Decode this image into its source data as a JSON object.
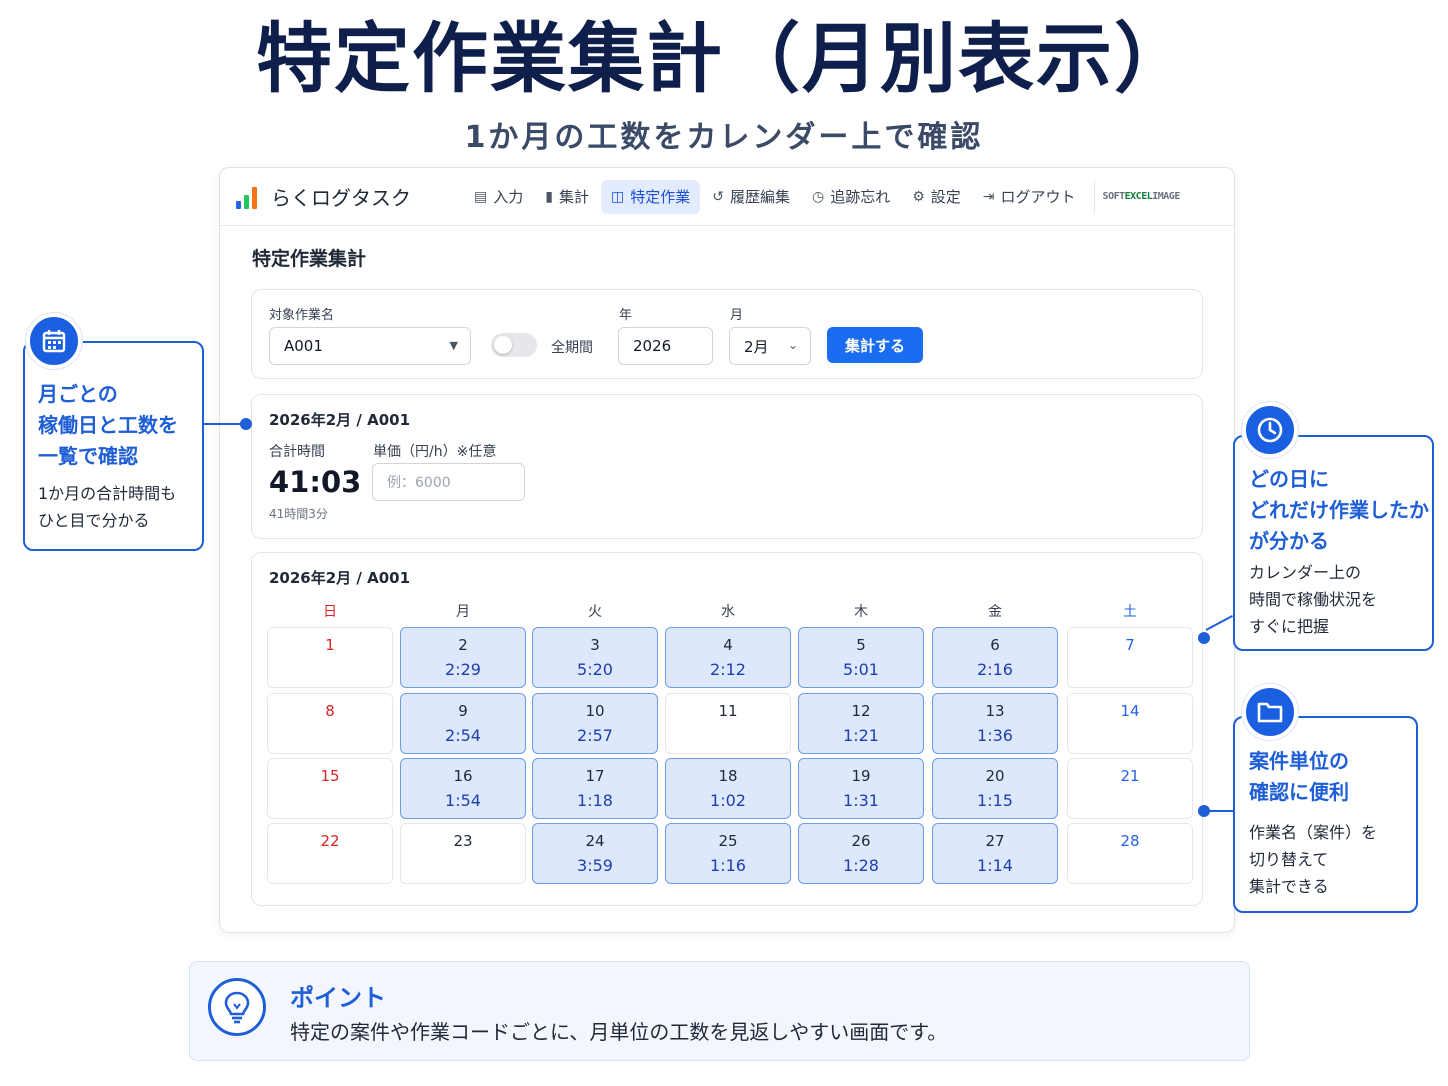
{
  "hero": {
    "title": "特定作業集計（月別表示）",
    "subtitle": "1か月の工数をカレンダー上で確認"
  },
  "app": {
    "brand_name": "らくログタスク",
    "nav": [
      {
        "label": "入力",
        "icon": "clipboard-icon"
      },
      {
        "label": "集計",
        "icon": "bar-chart-icon"
      },
      {
        "label": "特定作業",
        "icon": "book-icon",
        "active": true
      },
      {
        "label": "履歴編集",
        "icon": "history-icon"
      },
      {
        "label": "追跡忘れ",
        "icon": "clock-icon"
      },
      {
        "label": "設定",
        "icon": "gear-icon"
      },
      {
        "label": "ログアウト",
        "icon": "logout-icon"
      }
    ],
    "vendor_logo": {
      "soft": "SOFT",
      "excel": "EXCEL",
      "image": "IMAGE"
    },
    "page_title": "特定作業集計",
    "filter": {
      "task_label": "対象作業名",
      "task_value": "A001",
      "all_period_label": "全期間",
      "all_period_on": false,
      "year_label": "年",
      "year_value": "2026",
      "month_label": "月",
      "month_value": "2月",
      "submit_label": "集計する"
    },
    "summary": {
      "caption": "2026年2月 / A001",
      "total_label": "合計時間",
      "total_value": "41:03",
      "total_sub": "41時間3分",
      "price_label": "単価（円/h）※任意",
      "price_placeholder": "例：6000"
    },
    "calendar": {
      "caption": "2026年2月 / A001",
      "weekdays": [
        "日",
        "月",
        "火",
        "水",
        "木",
        "金",
        "土"
      ],
      "weeks": [
        [
          {
            "day": "1",
            "hours": ""
          },
          {
            "day": "2",
            "hours": "2:29"
          },
          {
            "day": "3",
            "hours": "5:20"
          },
          {
            "day": "4",
            "hours": "2:12"
          },
          {
            "day": "5",
            "hours": "5:01"
          },
          {
            "day": "6",
            "hours": "2:16"
          },
          {
            "day": "7",
            "hours": ""
          }
        ],
        [
          {
            "day": "8",
            "hours": ""
          },
          {
            "day": "9",
            "hours": "2:54"
          },
          {
            "day": "10",
            "hours": "2:57"
          },
          {
            "day": "11",
            "hours": ""
          },
          {
            "day": "12",
            "hours": "1:21"
          },
          {
            "day": "13",
            "hours": "1:36"
          },
          {
            "day": "14",
            "hours": ""
          }
        ],
        [
          {
            "day": "15",
            "hours": ""
          },
          {
            "day": "16",
            "hours": "1:54"
          },
          {
            "day": "17",
            "hours": "1:18"
          },
          {
            "day": "18",
            "hours": "1:02"
          },
          {
            "day": "19",
            "hours": "1:31"
          },
          {
            "day": "20",
            "hours": "1:15"
          },
          {
            "day": "21",
            "hours": ""
          }
        ],
        [
          {
            "day": "22",
            "hours": ""
          },
          {
            "day": "23",
            "hours": ""
          },
          {
            "day": "24",
            "hours": "3:59"
          },
          {
            "day": "25",
            "hours": "1:16"
          },
          {
            "day": "26",
            "hours": "1:28"
          },
          {
            "day": "27",
            "hours": "1:14"
          },
          {
            "day": "28",
            "hours": ""
          }
        ]
      ]
    }
  },
  "callouts": {
    "left": {
      "icon": "calendar-icon",
      "heading": [
        "月ごとの",
        "稼働日と工数を",
        "一覧で確認"
      ],
      "body": [
        "1か月の合計時間も",
        "ひと目で分かる"
      ]
    },
    "right_top": {
      "icon": "clock-icon",
      "heading": [
        "どの日に",
        "どれだけ作業したか",
        "が分かる"
      ],
      "body": [
        "カレンダー上の",
        "時間で稼働状況を",
        "すぐに把握"
      ]
    },
    "right_bottom": {
      "icon": "folder-icon",
      "heading": [
        "案件単位の",
        "確認に便利"
      ],
      "body": [
        "作業名（案件）を",
        "切り替えて",
        "集計できる"
      ]
    }
  },
  "point": {
    "icon": "lightbulb-icon",
    "title": "ポイント",
    "text": "特定の案件や作業コードごとに、月単位の工数を見返しやすい画面です。"
  },
  "colors": {
    "accent": "#1e5ed6",
    "primary_button": "#1a6cf0",
    "work_cell": "#dde8fc",
    "sunday": "#dc2626",
    "saturday": "#2563eb",
    "logo_bars": [
      "#2563eb",
      "#22c55e",
      "#f97316"
    ]
  }
}
